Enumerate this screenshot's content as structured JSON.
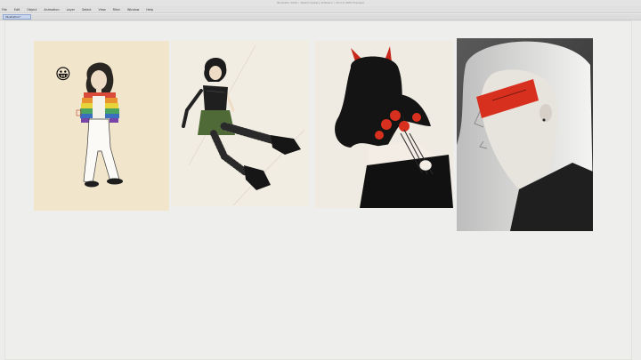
{
  "window": {
    "title": "Illustrator 2020 • Sketch Gallery Artboard • Ctrl+0 (GPU Preview)"
  },
  "menu": {
    "items": [
      "File",
      "Edit",
      "Object",
      "Animation",
      "Layer",
      "Select",
      "View",
      "Filter",
      "Window",
      "Help"
    ]
  },
  "tabs": {
    "active_label": "Illustration*"
  },
  "artworks": [
    {
      "subject": "girl in rainbow striped sweater and white flared pants",
      "sticker": "😀"
    },
    {
      "subject": "girl in green skirt kicking with platform boots"
    },
    {
      "subject": "horned girl seen from behind holding red roses"
    },
    {
      "subject": "white-haired girl profile with red blindfold"
    }
  ],
  "colors": {
    "accent_red": "#d8301f",
    "rainbow": [
      "#d94a3a",
      "#e8932f",
      "#e8d33b",
      "#4aa360",
      "#3a6fbf",
      "#7a45a8"
    ],
    "skirt_green": "#4f6a36"
  }
}
